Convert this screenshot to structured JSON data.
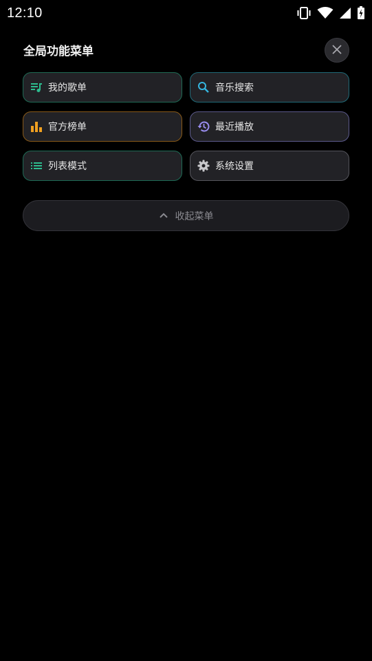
{
  "status_bar": {
    "time": "12:10",
    "icons": [
      "vibrate-icon",
      "wifi-icon",
      "signal-icon",
      "battery-icon"
    ]
  },
  "panel": {
    "title": "全局功能菜单",
    "close_icon": "close-icon"
  },
  "menu": {
    "items": [
      {
        "label": "我的歌单",
        "icon": "playlist-icon",
        "color": "#2dbd8f"
      },
      {
        "label": "音乐搜索",
        "icon": "search-icon",
        "color": "#35b6e0"
      },
      {
        "label": "官方榜单",
        "icon": "bar-chart-icon",
        "color": "#f0a020"
      },
      {
        "label": "最近播放",
        "icon": "history-icon",
        "color": "#9a8ef0"
      },
      {
        "label": "列表模式",
        "icon": "list-icon",
        "color": "#2dbd8f"
      },
      {
        "label": "系统设置",
        "icon": "gear-icon",
        "color": "#c8c8cc"
      }
    ]
  },
  "collapse": {
    "label": "收起菜单",
    "icon": "chevron-up-icon"
  }
}
